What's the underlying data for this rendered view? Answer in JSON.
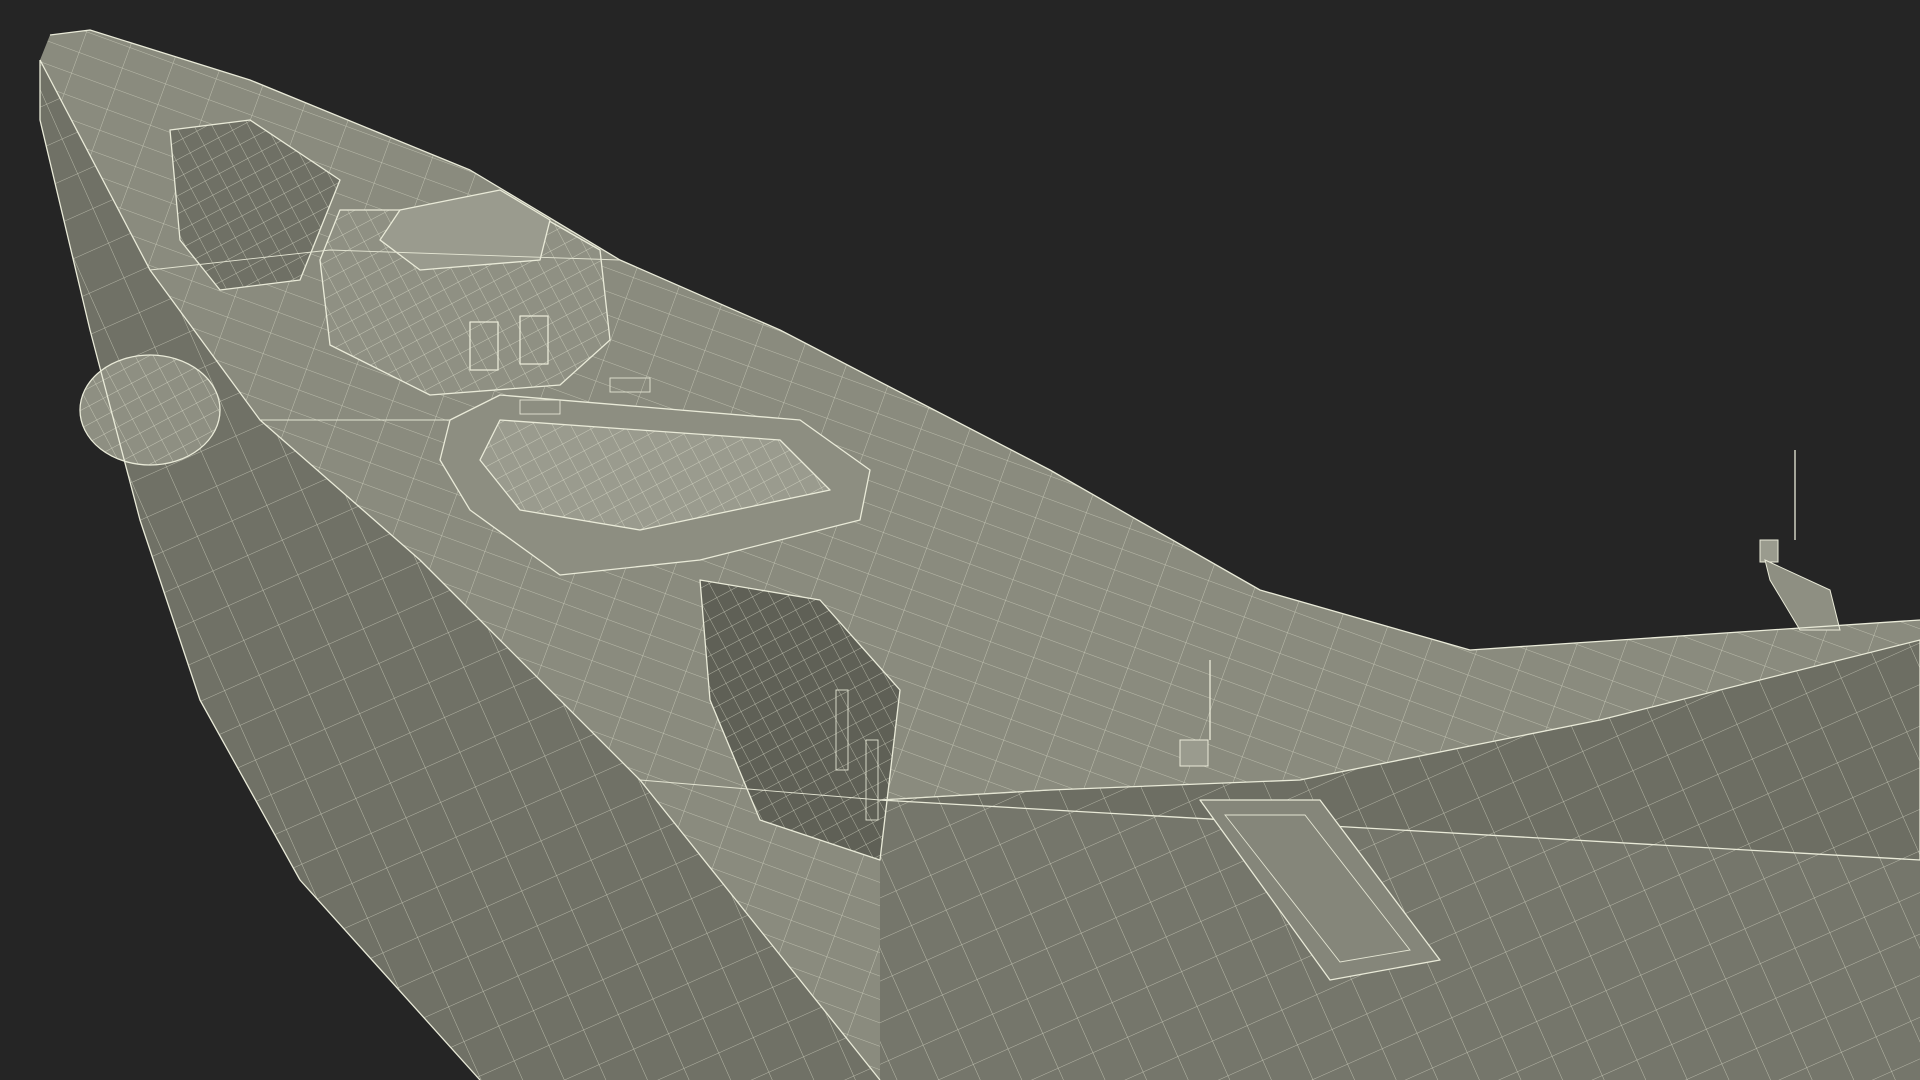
{
  "scene": {
    "subject": "stealth-warship-wireframe",
    "render_mode": "wireframe-on-shaded",
    "colors": {
      "background": "#252525",
      "hull_light": "#8c8d80",
      "hull_mid": "#7b7c70",
      "hull_dark": "#6a6b60",
      "hull_shadow": "#5c5d53",
      "wire": "#e9ead8"
    }
  }
}
